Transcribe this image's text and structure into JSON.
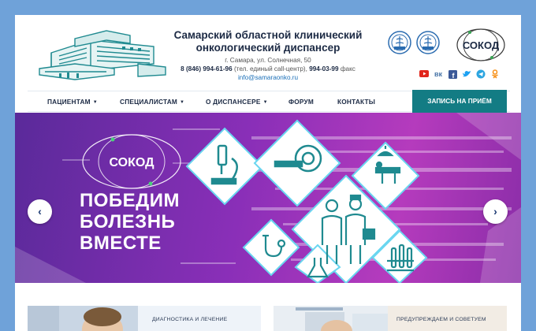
{
  "header": {
    "title_line1": "Самарский областной клинический",
    "title_line2": "онкологический диспансер",
    "address": "г. Самара, ул. Солнечная, 50",
    "phone_main": "8 (846) 994-61-96",
    "phone_note": "(тел. единый call-центр),",
    "fax_number": "994-03-99",
    "fax_label": "факс",
    "email": "info@samaraonko.ru",
    "logo_text": "СОКОД"
  },
  "nav": {
    "items": [
      "ПАЦИЕНТАМ",
      "СПЕЦИАЛИСТАМ",
      "О ДИСПАНСЕРЕ",
      "ФОРУМ",
      "КОНТАКТЫ"
    ],
    "cta": "Запись на приём"
  },
  "hero": {
    "line1": "ПОБЕДИМ",
    "line2": "БОЛЕЗНЬ",
    "line3": "ВМЕСТЕ",
    "logo_text": "СОКОД"
  },
  "cards": {
    "card1_label": "ДИАГНОСТИКА И ЛЕЧЕНИЕ",
    "card2_label": "ПРЕДУПРЕЖДАЕМ И СОВЕТУЕМ"
  },
  "colors": {
    "accent": "#137c84",
    "navy": "#1c2a44",
    "hero_purple": "#8a2fb8",
    "frame_blue": "#6fa2d9"
  },
  "icons": [
    "youtube-icon",
    "vk-icon",
    "facebook-icon",
    "twitter-icon",
    "telegram-icon",
    "odnoklassniki-icon"
  ]
}
